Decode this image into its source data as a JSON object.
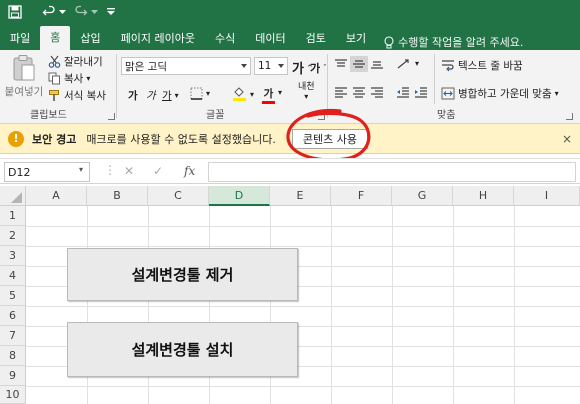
{
  "titlebar": {
    "icons": [
      "save-icon",
      "undo-icon",
      "redo-icon",
      "customize-icon"
    ]
  },
  "tabs": [
    {
      "label": "파일"
    },
    {
      "label": "홈"
    },
    {
      "label": "삽입"
    },
    {
      "label": "페이지 레이아웃"
    },
    {
      "label": "수식"
    },
    {
      "label": "데이터"
    },
    {
      "label": "검토"
    },
    {
      "label": "보기"
    }
  ],
  "active_tab": "홈",
  "tellme": {
    "placeholder": "수행할 작업을 알려 주세요."
  },
  "ribbon": {
    "clipboard": {
      "paste_label": "붙여넣기",
      "cut_label": "잘라내기",
      "copy_label": "복사",
      "format_painter_label": "서식 복사",
      "group_label": "클립보드"
    },
    "font": {
      "font_name": "맑은 고딕",
      "font_size": "11",
      "bold": "가",
      "italic": "가",
      "underline": "가",
      "grow": "가",
      "shrink": "가",
      "font_color_char": "가",
      "phonetic": "내천",
      "group_label": "글꼴"
    },
    "alignment": {
      "wrap_text_label": "텍스트 줄 바꿈",
      "merge_label": "병합하고 가운데 맞춤",
      "group_label": "맞춤"
    }
  },
  "security_bar": {
    "title": "보안 경고",
    "message": "매크로를 사용할 수 없도록 설정했습니다.",
    "enable_button": "콘텐츠 사용",
    "close_glyph": "×"
  },
  "formula_bar": {
    "name_box": "D12",
    "cancel_glyph": "✕",
    "enter_glyph": "✓",
    "fx_glyph": "fx",
    "formula": ""
  },
  "sheet": {
    "columns": [
      "A",
      "B",
      "C",
      "D",
      "E",
      "F",
      "G",
      "H",
      "I"
    ],
    "selected_column": "D",
    "rows": [
      "1",
      "2",
      "3",
      "4",
      "5",
      "6",
      "7",
      "8",
      "9",
      "10"
    ],
    "buttons": [
      {
        "label": "설계변경툴 제거"
      },
      {
        "label": "설계변경툴 설치"
      }
    ]
  },
  "colors": {
    "excel_green": "#217346",
    "security_bar_bg": "#fff3c7",
    "annotation_red": "#e0201c"
  }
}
